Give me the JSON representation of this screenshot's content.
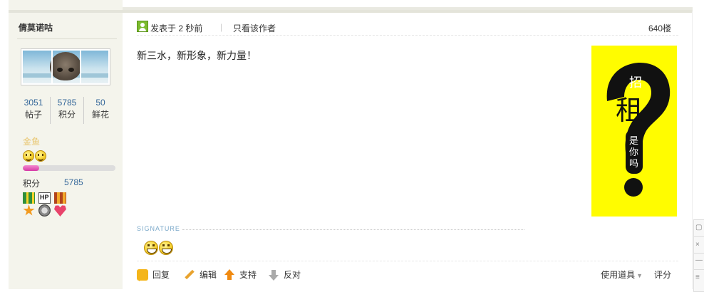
{
  "author": {
    "username": "倩莫诺咕",
    "stats": [
      {
        "value": "3051",
        "label": "帖子"
      },
      {
        "value": "5785",
        "label": "积分"
      },
      {
        "value": "50",
        "label": "鲜花"
      }
    ],
    "rank": "金鱼",
    "score_label": "积分",
    "score_value": "5785",
    "level_progress_percent": 18
  },
  "post": {
    "posted_prefix": "发表于",
    "posted_time": "2 秒前",
    "separator": "|",
    "only_author": "只看该作者",
    "floor": "640楼",
    "content": "新三水，新形象，新力量！",
    "ad": {
      "top_char": "招",
      "big_char": "租",
      "vertical_text": [
        "是",
        "你",
        "吗"
      ],
      "bg_color": "#fffc00"
    },
    "signature_label": "SIGNATURE"
  },
  "actions": {
    "reply": "回复",
    "edit": "编辑",
    "support": "支持",
    "oppose": "反对",
    "use_tools": "使用道具",
    "rate": "评分"
  },
  "side_widget": {
    "glyphs": [
      "▢",
      "×",
      "—",
      "≡"
    ]
  },
  "colors": {
    "link_blue": "#336699",
    "sidebar_bg": "#f4f4ec",
    "rank_gold": "#e8c46a",
    "signature_blue": "#7aa8c9"
  }
}
